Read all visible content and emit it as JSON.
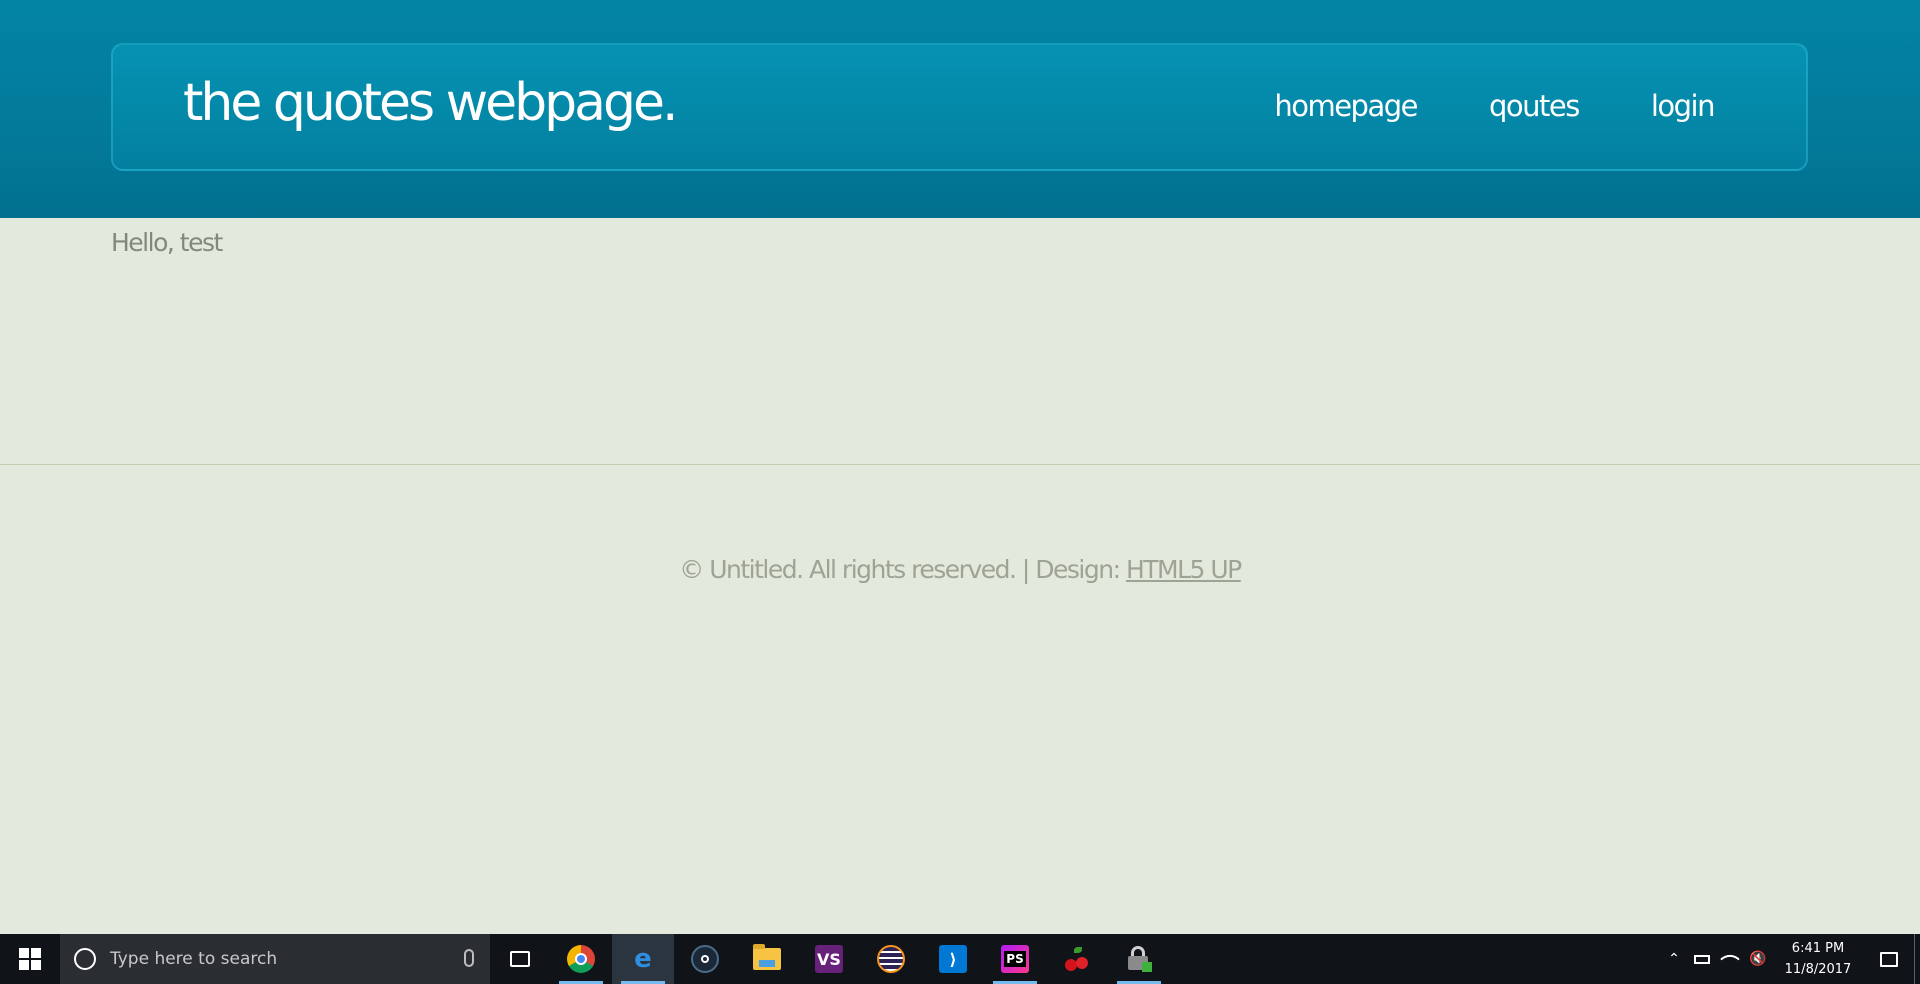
{
  "header": {
    "site_title": "the quotes webpage.",
    "nav": [
      {
        "label": "homepage"
      },
      {
        "label": "qoutes"
      },
      {
        "label": "login"
      }
    ]
  },
  "main": {
    "greeting": "Hello, test"
  },
  "footer": {
    "copyright": "© Untitled. All rights reserved. | Design: ",
    "design_link": "HTML5 UP"
  },
  "taskbar": {
    "search_placeholder": "Type here to search",
    "apps": [
      {
        "icon": "chrome-icon",
        "running": true,
        "active": false
      },
      {
        "icon": "edge-icon",
        "running": true,
        "active": true
      },
      {
        "icon": "steam-icon",
        "running": false,
        "active": false
      },
      {
        "icon": "file-explorer-icon",
        "running": false,
        "active": false
      },
      {
        "icon": "visual-studio-icon",
        "running": false,
        "active": false
      },
      {
        "icon": "eclipse-icon",
        "running": false,
        "active": false
      },
      {
        "icon": "vscode-icon",
        "running": false,
        "active": false
      },
      {
        "icon": "phpstorm-icon",
        "running": true,
        "active": false
      },
      {
        "icon": "cherry-icon",
        "running": false,
        "active": false
      },
      {
        "icon": "lock-app-icon",
        "running": true,
        "active": false
      }
    ],
    "clock": {
      "time": "6:41 PM",
      "date": "11/8/2017"
    }
  },
  "colors": {
    "header_bg": "#037a9a",
    "page_bg": "#e4e9dd",
    "taskbar_bg": "#101418",
    "accent": "#76b9ed"
  }
}
